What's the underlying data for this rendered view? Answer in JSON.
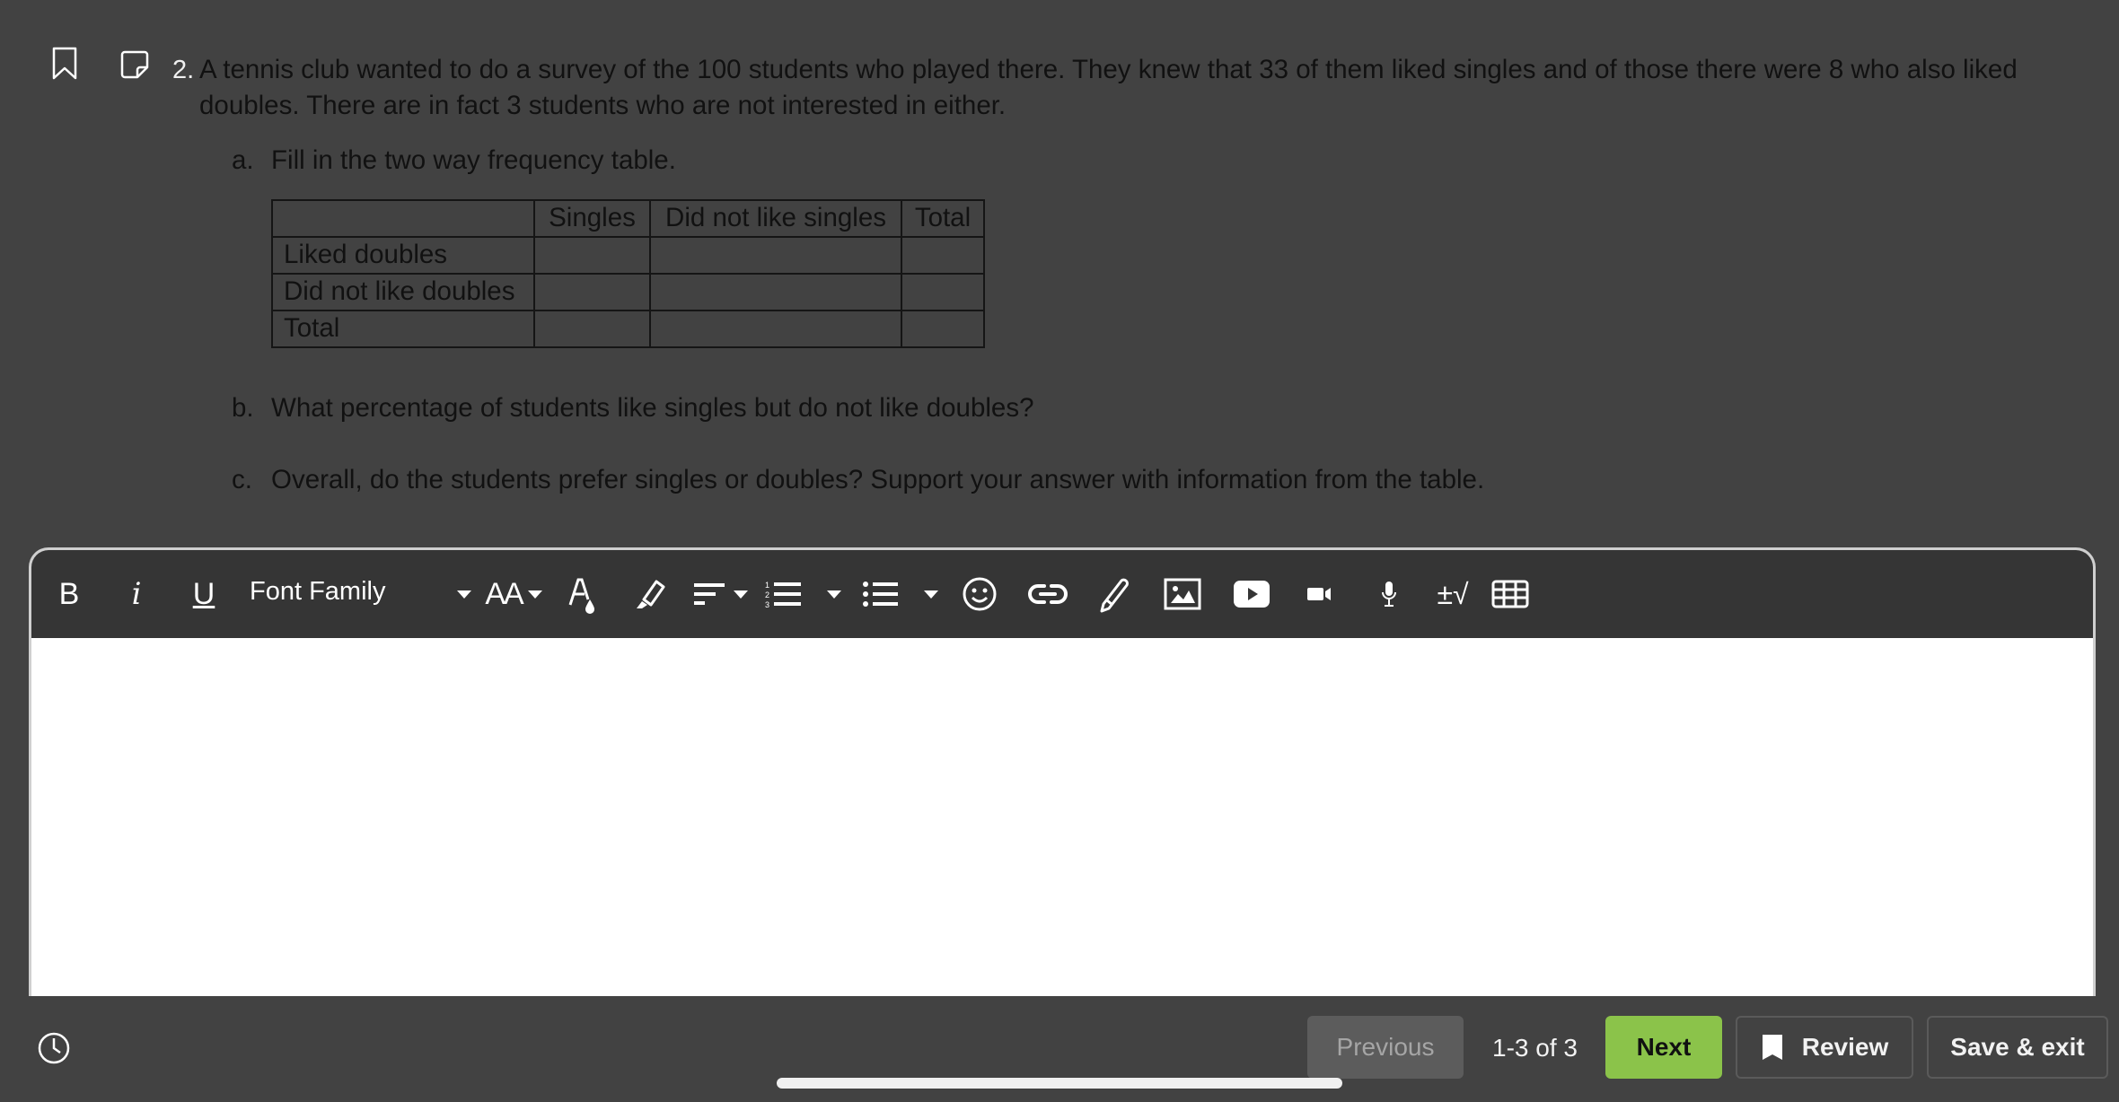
{
  "question": {
    "number": "2.",
    "text": "A tennis club wanted to do a survey of the 100 students who played there. They knew that 33 of them liked singles and of those there were 8 who also liked doubles. There are in fact 3 students who are not interested in either.",
    "parts": [
      {
        "label": "a.",
        "text": "Fill in the two way frequency table."
      },
      {
        "label": "b.",
        "text": "What percentage of students like singles but do not like doubles?"
      },
      {
        "label": "c.",
        "text": "Overall, do the students prefer singles or doubles? Support your answer with information from the table."
      }
    ],
    "table": {
      "headers": [
        "",
        "Singles",
        "Did not like singles",
        "Total"
      ],
      "rows": [
        [
          "Liked doubles",
          "",
          "",
          ""
        ],
        [
          "Did not like doubles",
          "",
          "",
          ""
        ],
        [
          "Total",
          "",
          "",
          ""
        ]
      ]
    }
  },
  "toolbar": {
    "bold": "B",
    "italic": "i",
    "underline": "U",
    "font_family": "Font Family",
    "font_size": "AA",
    "math": "±√"
  },
  "editor": {
    "value": ""
  },
  "footer": {
    "previous": "Previous",
    "counter": "1-3 of 3",
    "next": "Next",
    "review": "Review",
    "save_exit": "Save & exit"
  },
  "colors": {
    "accent": "#8bc34a",
    "background": "#424242",
    "toolbar": "#353535"
  }
}
